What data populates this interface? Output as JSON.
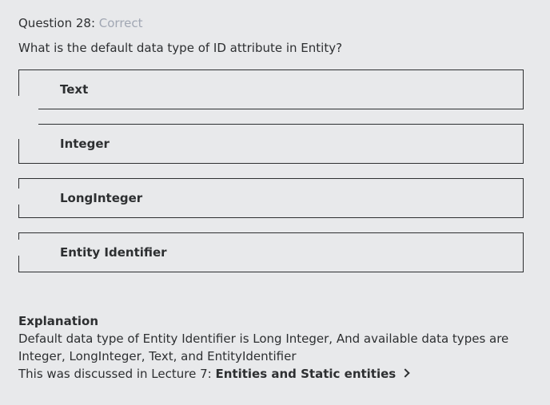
{
  "question": {
    "header_prefix": "Question 28:",
    "status": "Correct",
    "text": "What is the default data type of ID attribute in Entity?"
  },
  "answers": [
    {
      "label": "Text"
    },
    {
      "label": "Integer"
    },
    {
      "label": "LongInteger"
    },
    {
      "label": "Entity Identifier"
    }
  ],
  "explanation": {
    "title": "Explanation",
    "body": "Default data type of Entity Identifier is Long Integer, And available data types are  Integer, LongInteger, Text, and EntityIdentifier",
    "lecture_prefix": "This was discussed in Lecture 7:",
    "lecture_link": "Entities and Static entities",
    "link_icon": "chevron-right-icon"
  }
}
